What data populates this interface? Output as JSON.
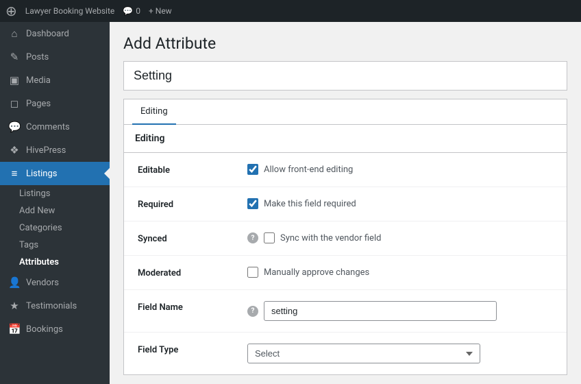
{
  "topbar": {
    "logo_label": "WordPress",
    "site_name": "Lawyer Booking Website",
    "comments_label": "0",
    "new_label": "+ New"
  },
  "sidebar": {
    "items": [
      {
        "id": "dashboard",
        "label": "Dashboard",
        "icon": "⌂"
      },
      {
        "id": "posts",
        "label": "Posts",
        "icon": "✎"
      },
      {
        "id": "media",
        "label": "Media",
        "icon": "🖼"
      },
      {
        "id": "pages",
        "label": "Pages",
        "icon": "📄"
      },
      {
        "id": "comments",
        "label": "Comments",
        "icon": "💬"
      },
      {
        "id": "hivepress",
        "label": "HivePress",
        "icon": "❖"
      },
      {
        "id": "listings",
        "label": "Listings",
        "icon": "≡",
        "active": true
      }
    ],
    "listings_sub": [
      {
        "id": "listings-list",
        "label": "Listings"
      },
      {
        "id": "add-new",
        "label": "Add New"
      },
      {
        "id": "categories",
        "label": "Categories"
      },
      {
        "id": "tags",
        "label": "Tags"
      },
      {
        "id": "attributes",
        "label": "Attributes",
        "active": true
      }
    ],
    "more_items": [
      {
        "id": "vendors",
        "label": "Vendors",
        "icon": "👤"
      },
      {
        "id": "testimonials",
        "label": "Testimonials",
        "icon": "★"
      },
      {
        "id": "bookings",
        "label": "Bookings",
        "icon": "📅"
      }
    ]
  },
  "page": {
    "title": "Add Attribute",
    "setting_placeholder": "Setting",
    "tab_editing": "Editing",
    "section_title": "Editing",
    "fields": {
      "editable": {
        "label": "Editable",
        "checkbox_label": "Allow front-end editing",
        "checked": true
      },
      "required": {
        "label": "Required",
        "checkbox_label": "Make this field required",
        "checked": true
      },
      "synced": {
        "label": "Synced",
        "checkbox_label": "Sync with the vendor field",
        "checked": false,
        "has_help": true
      },
      "moderated": {
        "label": "Moderated",
        "checkbox_label": "Manually approve changes",
        "checked": false
      },
      "field_name": {
        "label": "Field Name",
        "value": "setting",
        "has_help": true
      },
      "field_type": {
        "label": "Field Type",
        "value": "Select",
        "has_help": false
      }
    }
  }
}
